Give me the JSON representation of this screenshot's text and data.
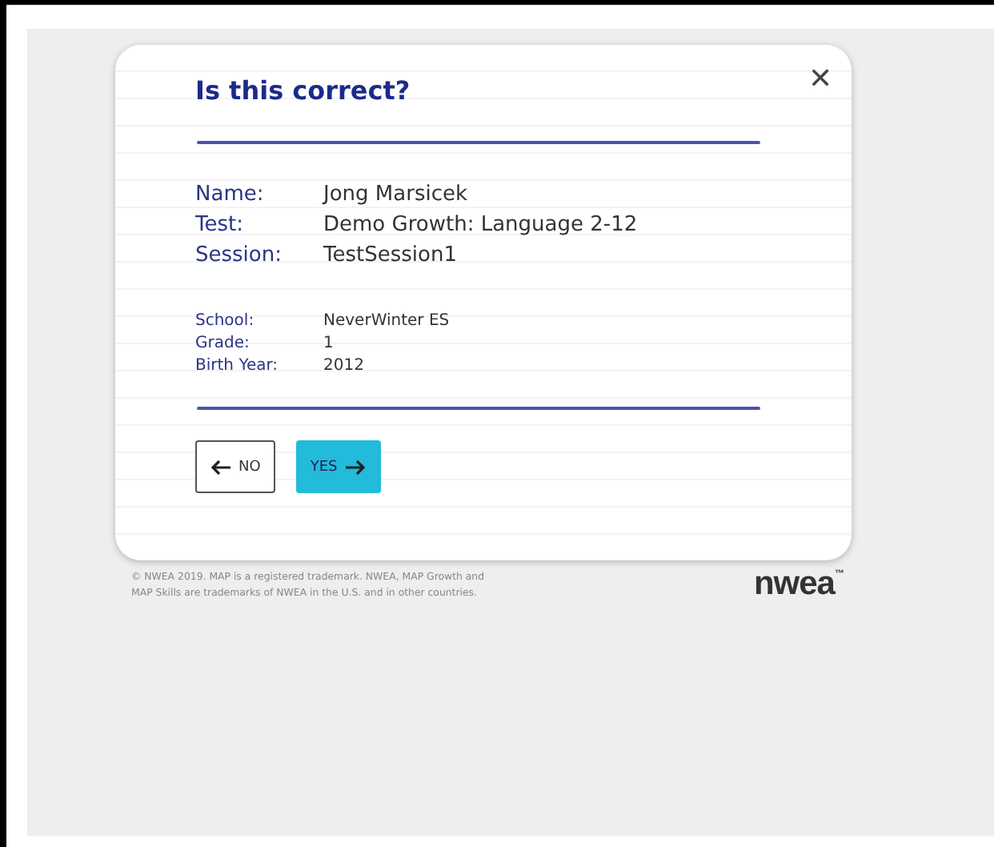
{
  "dialog": {
    "title": "Is this correct?",
    "close": "✕",
    "main_fields": [
      {
        "label": "Name:",
        "value": "Jong Marsicek"
      },
      {
        "label": "Test:",
        "value": "Demo Growth: Language 2-12"
      },
      {
        "label": "Session:",
        "value": "TestSession1"
      }
    ],
    "detail_fields": [
      {
        "label": "School:",
        "value": "NeverWinter ES"
      },
      {
        "label": "Grade:",
        "value": "1"
      },
      {
        "label": "Birth Year:",
        "value": "2012"
      }
    ],
    "buttons": [
      {
        "kind": "back",
        "label": "NO"
      },
      {
        "kind": "forward",
        "label": "YES"
      }
    ]
  },
  "footer": {
    "legal": [
      "© NWEA 2019. MAP is a registered trademark. NWEA, MAP Growth and",
      "MAP Skills are trademarks of NWEA in the U.S. and in other countries."
    ],
    "logo": "nwea",
    "logo_mark": "™"
  }
}
